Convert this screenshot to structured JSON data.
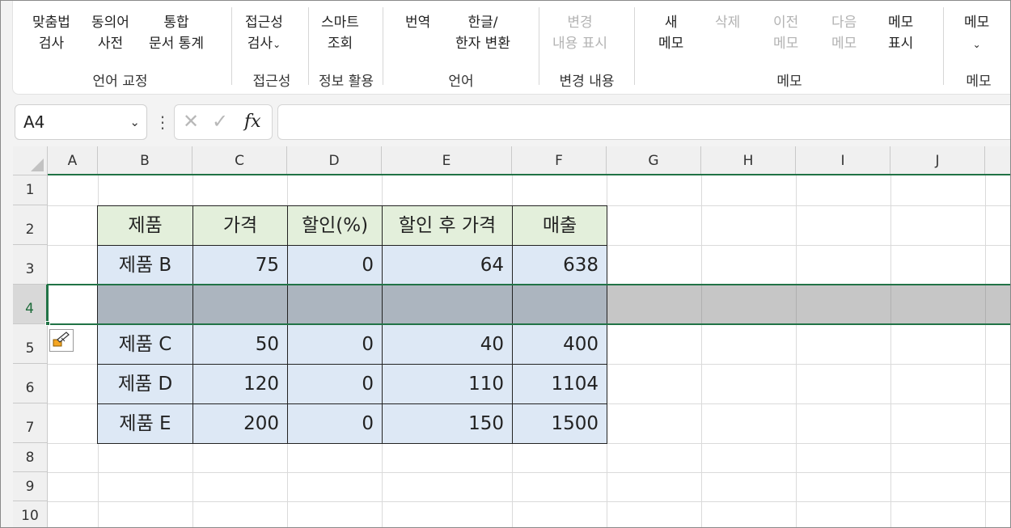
{
  "ribbon": {
    "groups": [
      {
        "label": "언어 교정",
        "buttons": [
          "맞춤법\n검사",
          "동의어\n사전",
          "통합\n문서 통계"
        ]
      },
      {
        "label": "접근성",
        "buttons": [
          "접근성\n검사"
        ]
      },
      {
        "label": "정보 활용",
        "buttons": [
          "스마트\n조회"
        ]
      },
      {
        "label": "언어",
        "buttons": [
          "번역",
          "한글/\n한자 변환"
        ]
      },
      {
        "label": "변경 내용",
        "buttons": [
          "변경\n내용 표시"
        ]
      },
      {
        "label": "메모",
        "buttons": [
          "새\n메모",
          "삭제",
          "이전\n메모",
          "다음\n메모",
          "메모\n표시"
        ]
      },
      {
        "label": "메모",
        "buttons": [
          "메모"
        ]
      }
    ],
    "dropdown_glyph": "⌄"
  },
  "formula_bar": {
    "name_box": "A4",
    "cancel": "✕",
    "enter": "✓",
    "fx": "fx",
    "value": ""
  },
  "columns": [
    "A",
    "B",
    "C",
    "D",
    "E",
    "F",
    "G",
    "H",
    "I",
    "J"
  ],
  "rows": [
    "1",
    "2",
    "3",
    "4",
    "5",
    "6",
    "7",
    "8",
    "9",
    "10"
  ],
  "table": {
    "header": [
      "제품",
      "가격",
      "할인(%)",
      "할인 후 가격",
      "매출"
    ],
    "rows": [
      [
        "제품 B",
        "75",
        "0",
        "64",
        "638"
      ],
      [
        "",
        "",
        "",
        "",
        ""
      ],
      [
        "제품 C",
        "50",
        "0",
        "40",
        "400"
      ],
      [
        "제품 D",
        "120",
        "0",
        "110",
        "1104"
      ],
      [
        "제품 E",
        "200",
        "0",
        "150",
        "1500"
      ]
    ]
  },
  "colors": {
    "accent": "#217346",
    "header_fill": "#e3efdb",
    "body_fill": "#dde8f5",
    "blank_row_fill": "#acb5bf"
  }
}
